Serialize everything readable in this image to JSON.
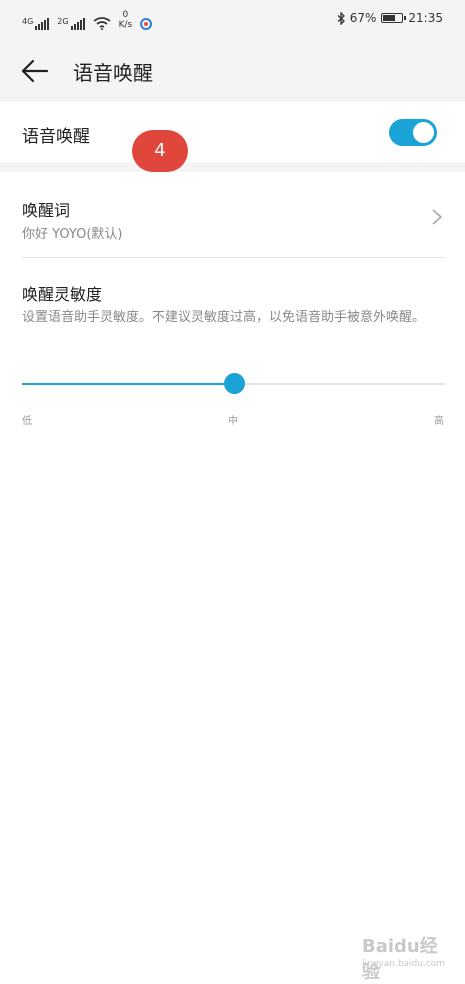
{
  "status_bar": {
    "sim1": "4G",
    "sim2": "2G",
    "net_speed_value": "0",
    "net_speed_unit": "K/s",
    "battery_percent": "67%",
    "battery_level": 0.67,
    "time": "21:35"
  },
  "app_bar": {
    "title": "语音唤醒"
  },
  "voice_wake": {
    "label": "语音唤醒",
    "enabled": true
  },
  "overlay_badge": "4",
  "wake_word": {
    "label": "唤醒词",
    "value": "你好 YOYO(默认)"
  },
  "sensitivity": {
    "label": "唤醒灵敏度",
    "description": "设置语音助手灵敏度。不建议灵敏度过高，以免语音助手被意外唤醒。",
    "level": 0.5,
    "levels": [
      "低",
      "中",
      "高"
    ]
  },
  "watermark": {
    "main": "Baidu经验",
    "sub": "jingyan.baidu.com"
  },
  "colors": {
    "accent": "#1aa3d6",
    "badge": "#e0463c",
    "bar_bg": "#f4f4f4"
  }
}
